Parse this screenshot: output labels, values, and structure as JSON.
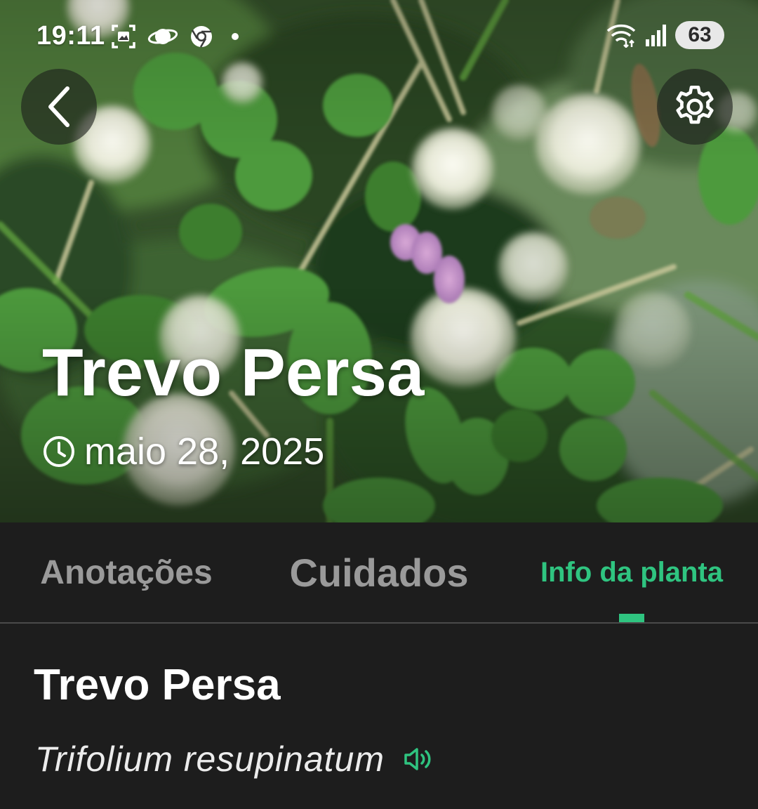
{
  "status_bar": {
    "time": "19:11",
    "battery": "63",
    "icons": [
      "screenshot-icon",
      "planet-icon",
      "chrome-icon",
      "dot-icon",
      "wifi-icon",
      "signal-icon"
    ]
  },
  "header": {
    "back_icon": "chevron-left-icon",
    "settings_icon": "gear-icon"
  },
  "plant": {
    "title": "Trevo Persa",
    "date": "maio 28, 2025",
    "date_icon": "clock-icon"
  },
  "tabs": [
    {
      "label": "Anotações",
      "active": false
    },
    {
      "label": "Cuidados",
      "active": false
    },
    {
      "label": "Info da planta",
      "active": true
    }
  ],
  "info": {
    "common_name": "Trevo Persa",
    "scientific_name": "Trifolium resupinatum",
    "speaker_icon": "speaker-icon"
  },
  "colors": {
    "accent": "#2fc480",
    "background": "#1d1d1d",
    "inactive_tab": "#9a9a9a"
  }
}
